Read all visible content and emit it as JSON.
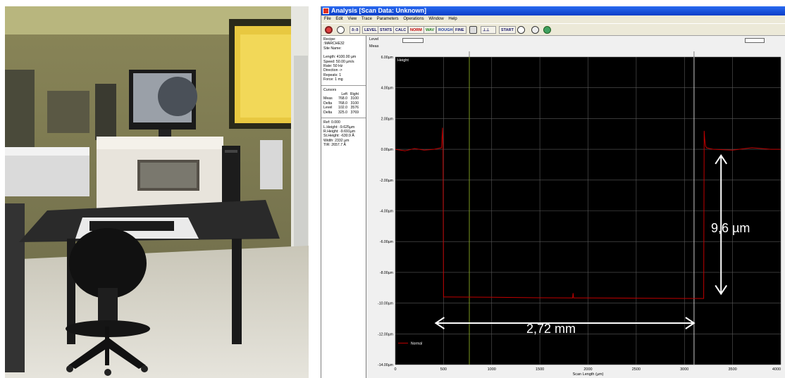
{
  "window": {
    "title": "Analysis [Scan Data: Unknown]",
    "menu": [
      "File",
      "Edit",
      "View",
      "Trace",
      "Parameters",
      "Operations",
      "Window",
      "Help"
    ]
  },
  "toolbar": {
    "buttons": [
      "LEVEL",
      "STATS",
      "CALC",
      "NORM",
      "WAV",
      "ROUGH",
      "FINE",
      "START"
    ]
  },
  "recipe": {
    "recipe_label": "Recipe:",
    "recipe_name": ":MARCHE32",
    "site_name": "Site Name:",
    "length": "Length: 4100.00 µm",
    "speed": "Speed: 50.00 µm/s",
    "rate": "Rate: 50 Hz",
    "direction": "Direction ->",
    "repeats": "Repeats: 1",
    "force": "Force: 1 mg"
  },
  "cursors": {
    "title": "Cursors",
    "col_left": "Left",
    "col_right": "Right",
    "rows": [
      {
        "name": "Meas",
        "left": "768.0",
        "right": "3100"
      },
      {
        "name": "Delta",
        "left": "768.0",
        "right": "3100"
      },
      {
        "name": "Level",
        "left": "102.0",
        "right": "3576"
      },
      {
        "name": "Delta",
        "left": "325.0",
        "right": "3769"
      }
    ]
  },
  "results": {
    "ref": "Ref:           0.000",
    "l_height": "L.Height:  -9.625µm",
    "r_height": "R.Height:  -9.691µm",
    "st_height": "St.Height: -630.9 Å",
    "width": "Width:       2332 µm",
    "tir": "TIR:         2657.7 Å"
  },
  "level_bar": {
    "level_label": "Level",
    "meas_label": "Meas"
  },
  "chart_data": {
    "type": "line",
    "title": "",
    "xlabel": "Scan Length (µm)",
    "ylabel": "Height",
    "xlim": [
      0,
      4000
    ],
    "ylim": [
      -14,
      6
    ],
    "x_ticks": [
      0,
      500,
      1000,
      1500,
      2000,
      2500,
      3000,
      3500,
      4000
    ],
    "x_tick_labels": [
      "0",
      "500",
      "1000",
      "1500",
      "2000",
      "2500",
      "3000",
      "3500",
      "4000"
    ],
    "y_ticks": [
      6,
      4,
      2,
      0,
      -2,
      -4,
      -6,
      -8,
      -10,
      -12,
      -14
    ],
    "y_tick_labels": [
      "6.00µm",
      "4.00µm",
      "2.00µm",
      "0.00µm",
      "-2.00µm",
      "-4.00µm",
      "-6.00µm",
      "-8.00µm",
      "-10.00µm",
      "-12.00µm",
      "-14.00µm"
    ],
    "grid": true,
    "legend_position": "bottom-left",
    "series": [
      {
        "name": "Normal",
        "color": "#c00000",
        "x": [
          0,
          100,
          200,
          300,
          400,
          480,
          490,
          495,
          500,
          505,
          510,
          1000,
          1500,
          1840,
          1845,
          1850,
          2000,
          2500,
          3000,
          3200,
          3205,
          3210,
          3215,
          3220,
          3230,
          3260,
          3300,
          3500,
          3700,
          3900,
          4000
        ],
        "y": [
          0.0,
          -0.1,
          0.05,
          -0.05,
          0.0,
          0.1,
          1.4,
          0.0,
          -9.6,
          -9.6,
          -9.6,
          -9.62,
          -9.65,
          -9.66,
          -9.35,
          -9.66,
          -9.66,
          -9.68,
          -9.7,
          -9.7,
          1.2,
          0.7,
          0.4,
          0.2,
          0.1,
          0.05,
          0.0,
          -0.05,
          0.1,
          0.0,
          0.0
        ]
      }
    ],
    "cursors": [
      {
        "x": 768,
        "color": "#7a9a20"
      },
      {
        "x": 3100,
        "color": "#c8c8c8"
      }
    ]
  },
  "annotations": {
    "step_height": "9,6 µm",
    "width": "2,72 mm"
  }
}
